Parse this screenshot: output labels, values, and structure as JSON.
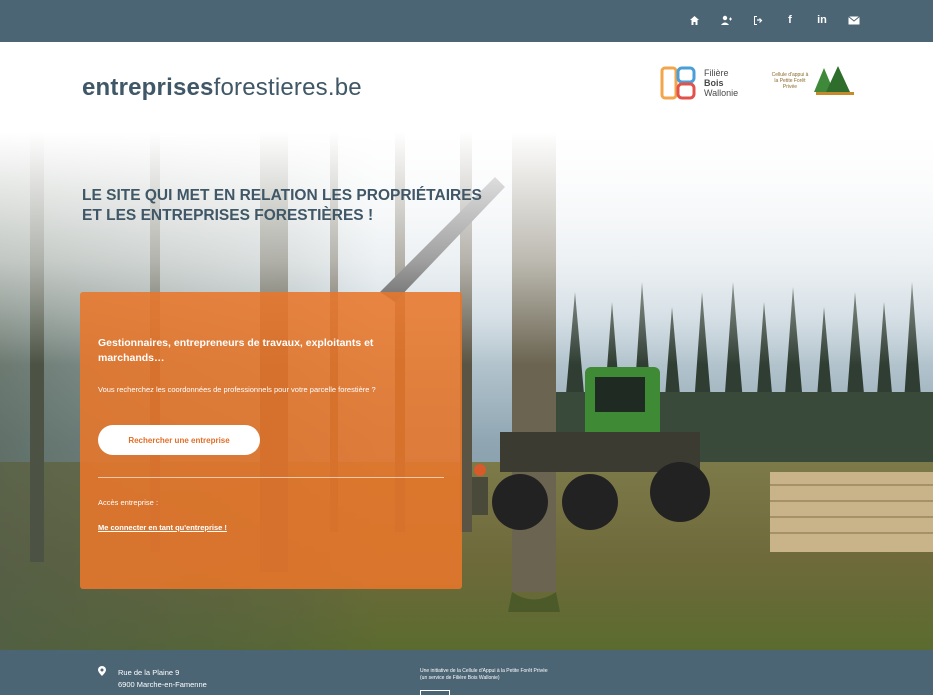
{
  "colors": {
    "topbar": "#4b6575",
    "brand": "#3f5766",
    "accent": "#e8762a",
    "white": "#ffffff"
  },
  "topbar": {
    "icons": [
      "home-icon",
      "user-add-icon",
      "login-icon",
      "facebook-icon",
      "linkedin-icon",
      "mail-icon"
    ],
    "facebook_glyph": "f",
    "linkedin_glyph": "in"
  },
  "header": {
    "brand_bold": "entreprises",
    "brand_light": "forestieres.be",
    "logo_fbw": {
      "line1": "Filière",
      "line2": "Bois",
      "line3": "Wallonie"
    },
    "logo_cellule": {
      "text": "Cellule d'appui à la Petite Forêt Privée"
    }
  },
  "hero": {
    "title_line1": "LE SITE QUI MET EN RELATION LES PROPRIÉTAIRES",
    "title_line2": "ET LES ENTREPRISES FORESTIÈRES !"
  },
  "card": {
    "heading": "Gestionnaires, entrepreneurs de travaux, exploitants et marchands…",
    "subtext": "Vous recherchez les coordonnées de professionnels pour votre parcelle forestière ?",
    "button_label": "Rechercher une entreprise",
    "access_label": "Accès entreprise :",
    "login_link": "Me connecter en tant qu'entreprise !"
  },
  "footer": {
    "address_line1": "Rue de la Plaine 9",
    "address_line2": "6900 Marche-en-Famenne",
    "initiative_line1": "Une initiative de la Cellule d'Appui à la Petite Forêt Privée",
    "initiative_line2": "(un service de Filière Bois Wallonie)"
  }
}
